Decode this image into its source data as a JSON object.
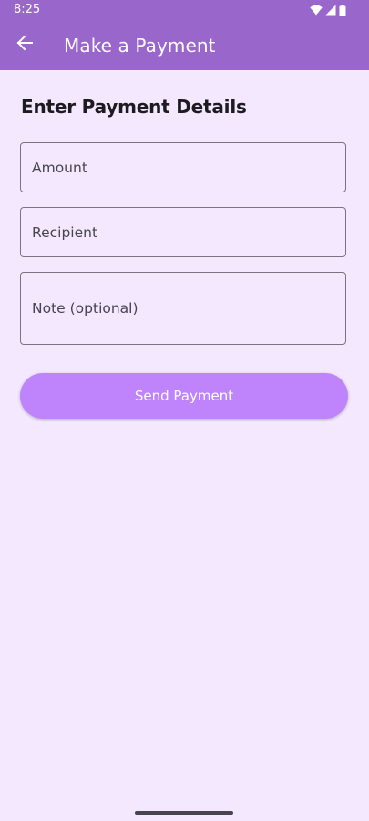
{
  "status_bar": {
    "time": "8:25",
    "icons": [
      "wifi-icon",
      "signal-icon",
      "battery-icon"
    ]
  },
  "app_bar": {
    "back_icon": "arrow-left-icon",
    "title": "Make a Payment"
  },
  "form": {
    "heading": "Enter Payment Details",
    "amount_label": "Amount",
    "recipient_label": "Recipient",
    "note_label": "Note (optional)",
    "submit_label": "Send Payment"
  },
  "colors": {
    "app_bar": "#9966CC",
    "background": "#F4E8FF",
    "button": "#BF84FB",
    "field_border": "#79747E"
  }
}
